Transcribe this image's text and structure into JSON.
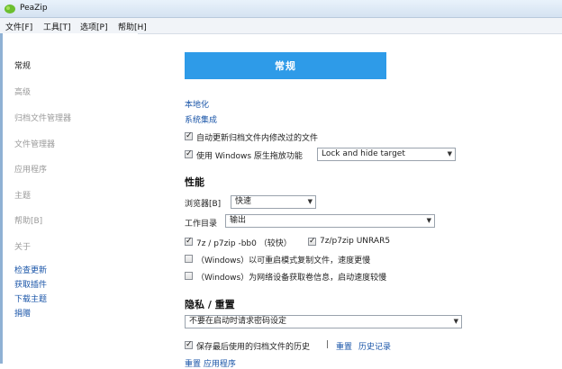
{
  "window": {
    "title": "PeaZip"
  },
  "menu": [
    "文件[F]",
    "工具[T]",
    "选项[P]",
    "帮助[H]"
  ],
  "sidebar": {
    "items": [
      {
        "label": "常规",
        "active": true
      },
      {
        "label": "高级",
        "active": false
      },
      {
        "label": "归档文件管理器",
        "active": false
      },
      {
        "label": "文件管理器",
        "active": false
      },
      {
        "label": "应用程序",
        "active": false
      },
      {
        "label": "主题",
        "active": false
      },
      {
        "label": "帮助[B]",
        "active": false
      },
      {
        "label": "关于",
        "active": false
      }
    ],
    "links": [
      "检查更新",
      "获取插件",
      "下载主题",
      "捐赠"
    ]
  },
  "main": {
    "header": "常规",
    "localization_link": "本地化",
    "system_integration_link": "系统集成",
    "auto_update_label": "自动更新归档文件内修改过的文件",
    "native_drag_label": "使用 Windows 原生拖放功能",
    "native_drag_select": "Lock and hide target",
    "performance_title": "性能",
    "browser_label": "浏览器[B]",
    "browser_select": "快速",
    "workdir_label": "工作目录",
    "workdir_select": "输出",
    "opt_7z_label": "7z / p7zip -bb0 （较快）",
    "opt_unrar_label": "7z/p7zip UNRAR5",
    "opt_restart_label": "（Windows）以可重启模式复制文件，速度更慢",
    "opt_network_label": "（Windows）为网络设备获取卷信息，启动速度较慢",
    "privacy_title": "隐私 / 重置",
    "privacy_select": "不要在启动时请求密码设定",
    "save_history_label": "保存最后使用的归档文件的历史",
    "divider": "|",
    "reset_link": "重置",
    "history_link": "历史记录",
    "bottom_links": "重置 应用程序"
  },
  "colors": {
    "accent": "#2e9be8",
    "link": "#1a55a8"
  }
}
